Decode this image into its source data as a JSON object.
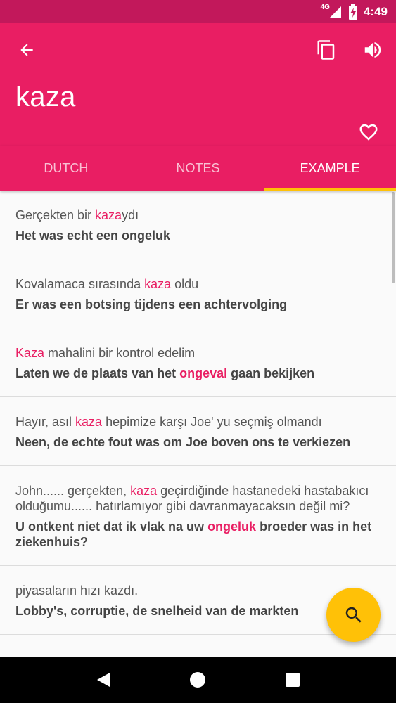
{
  "status_bar": {
    "network": "4G",
    "time": "4:49",
    "icons": [
      "signal-icon",
      "battery-charging-icon"
    ]
  },
  "app_bar": {
    "word": "kaza",
    "icons": [
      "back-arrow-icon",
      "copy-icon",
      "speaker-icon",
      "heart-outline-icon"
    ]
  },
  "tabs": [
    {
      "label": "DUTCH",
      "active": false
    },
    {
      "label": "NOTES",
      "active": false
    },
    {
      "label": "EXAMPLE",
      "active": true
    }
  ],
  "examples": [
    {
      "source": [
        {
          "t": "Gerçekten bir "
        },
        {
          "t": "kaza",
          "hl": true
        },
        {
          "t": "ydı"
        }
      ],
      "target": [
        {
          "t": "Het was echt een ongeluk"
        }
      ]
    },
    {
      "source": [
        {
          "t": "Kovalamaca sırasında "
        },
        {
          "t": "kaza",
          "hl": true
        },
        {
          "t": " oldu"
        }
      ],
      "target": [
        {
          "t": "Er was een botsing tijdens een achtervolging"
        }
      ]
    },
    {
      "source": [
        {
          "t": "Kaza",
          "hl": true
        },
        {
          "t": " mahalini bir kontrol edelim"
        }
      ],
      "target": [
        {
          "t": "Laten we de plaats van het "
        },
        {
          "t": "ongeval",
          "hl": true
        },
        {
          "t": " gaan bekijken"
        }
      ]
    },
    {
      "source": [
        {
          "t": "Hayır, asıl "
        },
        {
          "t": "kaza",
          "hl": true
        },
        {
          "t": " hepimize karşı Joe' yu seçmiş olmandı"
        }
      ],
      "target": [
        {
          "t": "Neen, de echte fout was om Joe boven ons te verkiezen"
        }
      ]
    },
    {
      "source": [
        {
          "t": "John...... gerçekten, "
        },
        {
          "t": "kaza",
          "hl": true
        },
        {
          "t": " geçirdiğinde hastanedeki hastabakıcı olduğumu...... hatırlamıyor gibi davranmayacaksın değil mi?"
        }
      ],
      "target": [
        {
          "t": "U ontkent niet dat ik vlak na uw "
        },
        {
          "t": "ongeluk",
          "hl": true
        },
        {
          "t": " broeder was in het ziekenhuis?"
        }
      ]
    },
    {
      "source": [
        {
          "t": "piyasaların hızı kazdı."
        }
      ],
      "target": [
        {
          "t": "Lobby's, corruptie, de snelheid van de markten"
        }
      ]
    }
  ],
  "fab": {
    "icon": "search-icon"
  },
  "nav_bar": {
    "icons": [
      "nav-back-icon",
      "nav-home-icon",
      "nav-recents-icon"
    ]
  },
  "colors": {
    "status_bar": "#c2185b",
    "primary": "#e91e63",
    "accent": "#ffc107",
    "highlight": "#e91e63"
  }
}
